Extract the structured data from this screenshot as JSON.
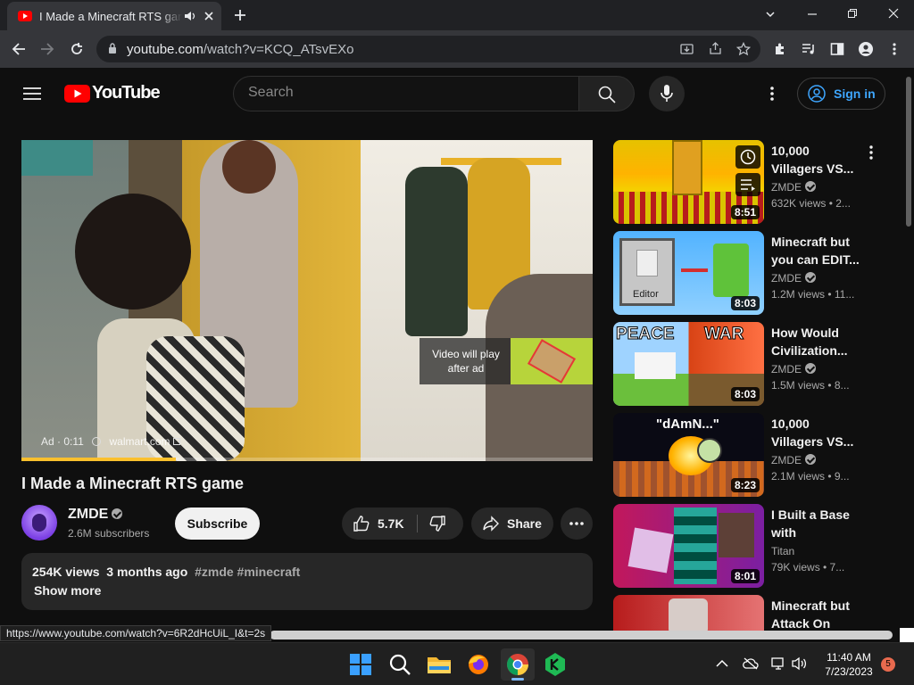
{
  "browser": {
    "tab_title": "I Made a Minecraft RTS game",
    "url_domain": "youtube.com",
    "url_path": "/watch?v=KCQ_ATsvEXo",
    "status_url": "https://www.youtube.com/watch?v=6R2dHcUiL_I&t=2s"
  },
  "header": {
    "logo_text": "YouTube",
    "search_placeholder": "Search",
    "signin_label": "Sign in"
  },
  "player": {
    "ad_label": "Ad · 0:11",
    "ad_domain": "walmart.com",
    "ad_overlay_text": "Video will play after ad",
    "progress": 0.27,
    "progress_color": "#fbc02d"
  },
  "video": {
    "title": "I Made a Minecraft RTS game",
    "channel": "ZMDE",
    "subscribers": "2.6M subscribers",
    "subscribe_label": "Subscribe",
    "likes": "5.7K",
    "share_label": "Share",
    "views": "254K views",
    "age": "3 months ago",
    "tags": "#zmde #minecraft",
    "show_more": "Show more"
  },
  "recommendations": [
    {
      "title": "10,000 Villagers VS...",
      "channel": "ZMDE",
      "verified": true,
      "stats": "632K views • 2...",
      "duration": "8:51"
    },
    {
      "title": "Minecraft but you can EDIT...",
      "channel": "ZMDE",
      "verified": true,
      "stats": "1.2M views • 11...",
      "duration": "8:03",
      "thumb_label": "Editor"
    },
    {
      "title": "How Would Civilization...",
      "channel": "ZMDE",
      "verified": true,
      "stats": "1.5M views • 8...",
      "duration": "8:03",
      "thumb_left": "PEACE",
      "thumb_right": "WAR"
    },
    {
      "title": "10,000 Villagers VS...",
      "channel": "ZMDE",
      "verified": true,
      "stats": "2.1M views • 9...",
      "duration": "8:23",
      "thumb_label": "\"dAmN...\""
    },
    {
      "title": "I Built a Base with Minecraf...",
      "channel": "Titan",
      "verified": false,
      "stats": "79K views • 7...",
      "duration": "8:01"
    },
    {
      "title": "Minecraft but Attack On Tita...",
      "channel": "",
      "verified": false,
      "stats": "",
      "duration": ""
    }
  ],
  "taskbar": {
    "time": "11:40 AM",
    "date": "7/23/2023",
    "notification_count": "5"
  }
}
